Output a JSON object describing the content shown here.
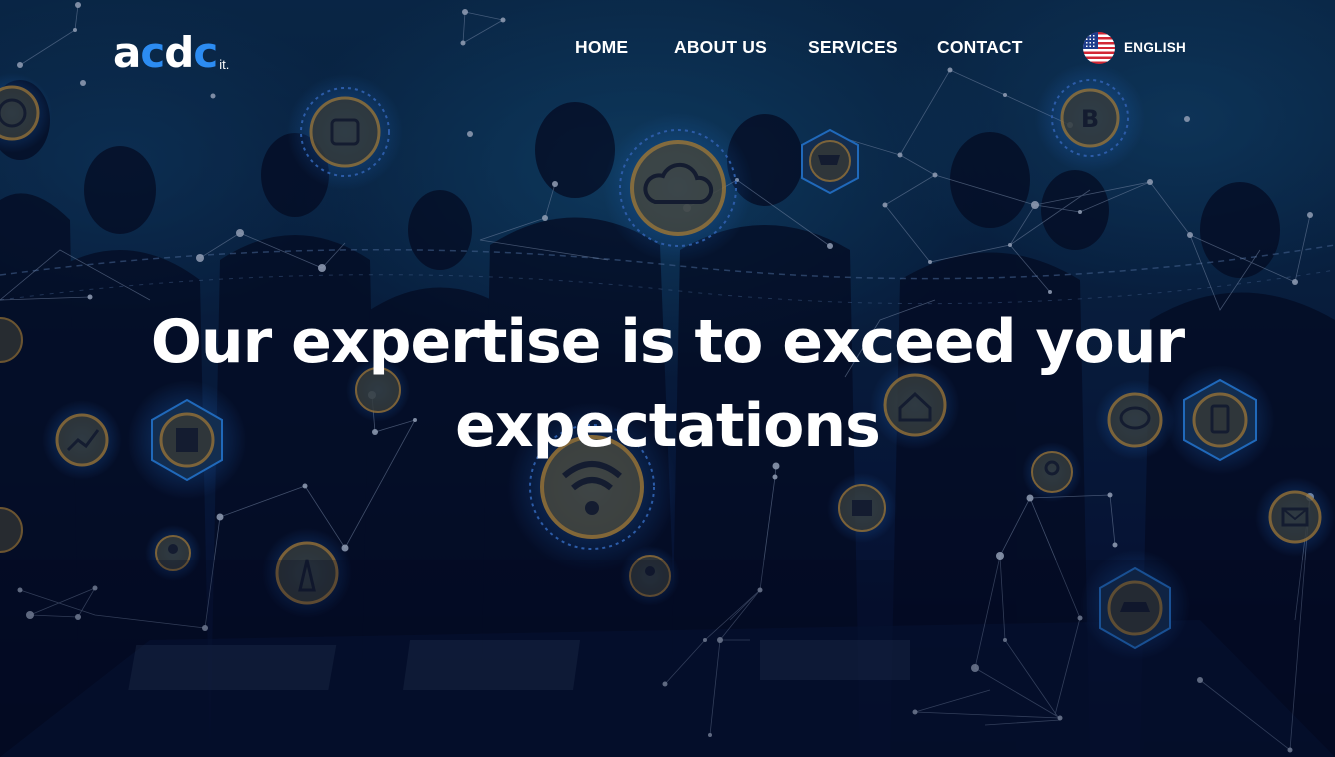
{
  "logo": {
    "main_part1": "a",
    "main_blue1": "c",
    "main_part2": "d",
    "main_blue2": "c",
    "sub": "it."
  },
  "nav": {
    "home": "HOME",
    "about": "ABOUT US",
    "services": "SERVICES",
    "contact": "CONTACT"
  },
  "language": {
    "label": "ENGLISH",
    "flag_icon": "us-flag-icon"
  },
  "hero": {
    "headline_line1": "Our expertise is to exceed your",
    "headline_line2": "expectations"
  },
  "colors": {
    "brand_blue": "#2c8cf2",
    "icon_gold": "#d19a3a",
    "network_blue": "#1e6fd9"
  }
}
